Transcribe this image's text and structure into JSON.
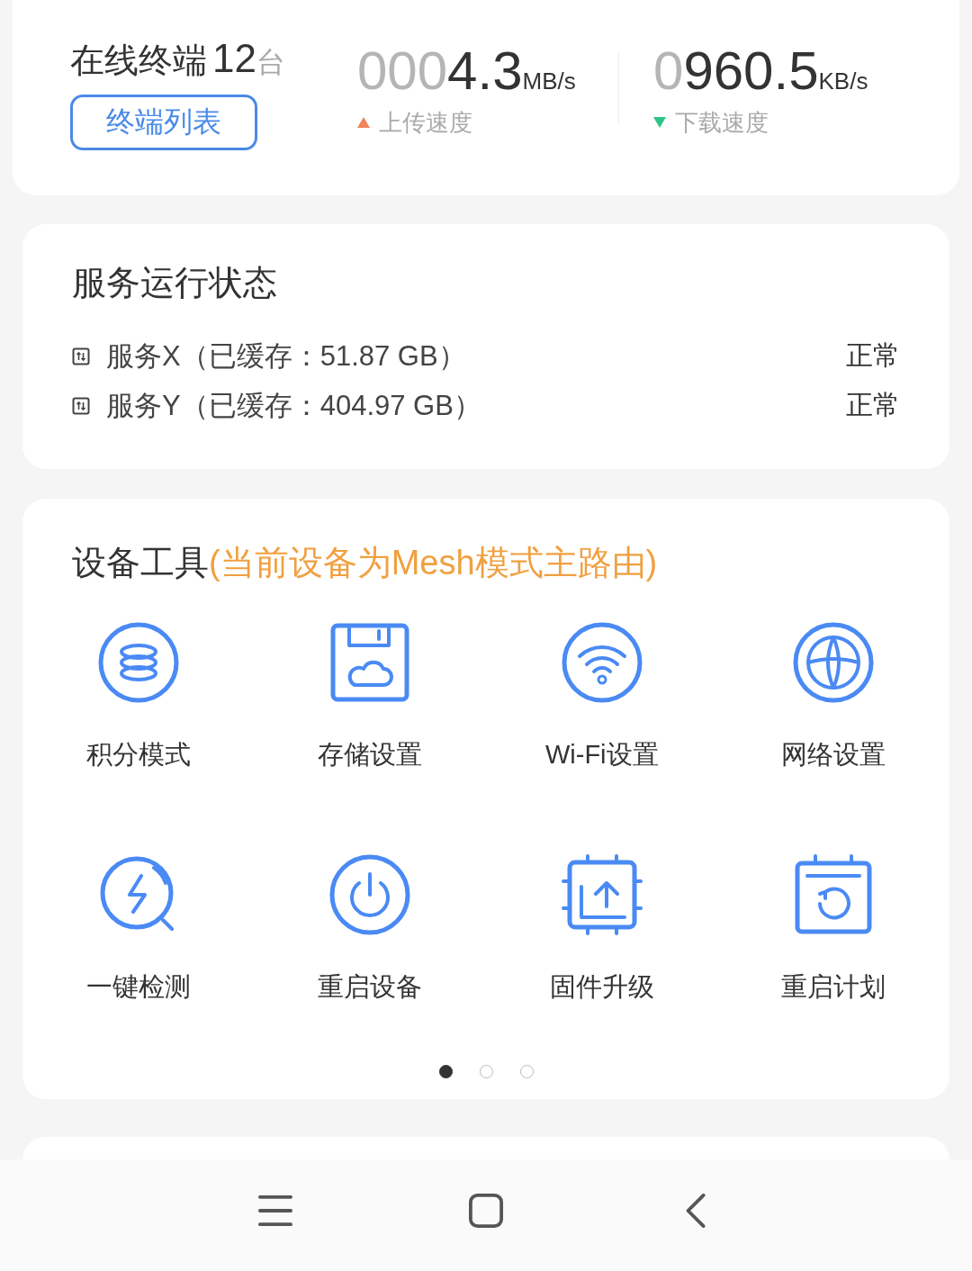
{
  "terminals": {
    "label": "在线终端",
    "count": "12",
    "unit": "台",
    "button": "终端列表"
  },
  "speeds": [
    {
      "kind": "up",
      "dim": "000",
      "value": "4.3",
      "unit": "MB/s",
      "label": "上传速度"
    },
    {
      "kind": "down",
      "dim": "0",
      "value": "960.5",
      "unit": "KB/s",
      "label": "下载速度"
    }
  ],
  "services": {
    "title": "服务运行状态",
    "items": [
      {
        "name": "服务X（已缓存：51.87 GB）",
        "status": "正常"
      },
      {
        "name": "服务Y（已缓存：404.97 GB）",
        "status": "正常"
      }
    ]
  },
  "tools": {
    "title": "设备工具",
    "note": "(当前设备为Mesh模式主路由)",
    "items": [
      {
        "label": "积分模式"
      },
      {
        "label": "存储设置"
      },
      {
        "label": "Wi-Fi设置"
      },
      {
        "label": "网络设置"
      },
      {
        "label": "一键检测"
      },
      {
        "label": "重启设备"
      },
      {
        "label": "固件升级"
      },
      {
        "label": "重启计划"
      }
    ],
    "pages": [
      {
        "selected": true
      },
      {
        "selected": false
      },
      {
        "selected": false
      }
    ]
  }
}
